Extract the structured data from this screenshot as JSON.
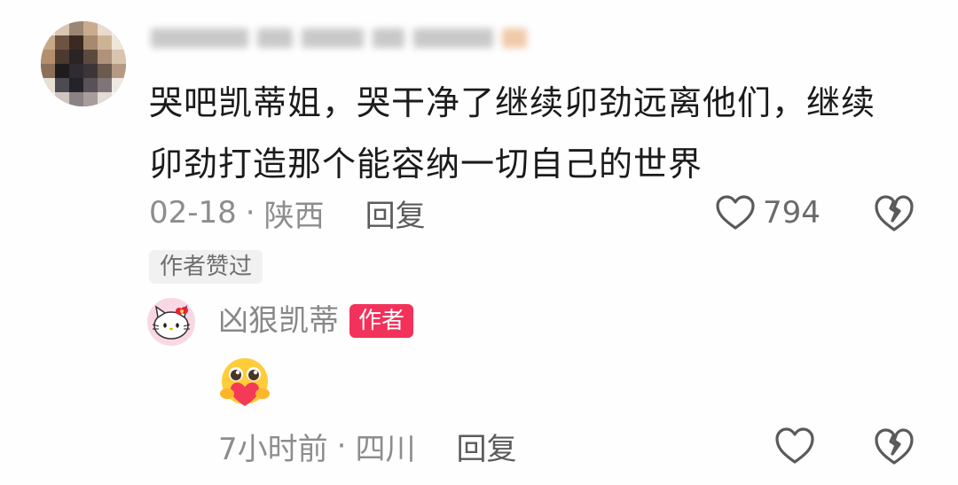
{
  "main_comment": {
    "text_line1": "哭吧凯蒂姐，哭干净了继续卯劲远离他们，继续",
    "text_line2": "卯劲打造那个能容纳一切自己的世界",
    "date": "02-18",
    "separator": "·",
    "location": "陕西",
    "reply_label": "回复",
    "like_count": "794",
    "author_liked_label": "作者赞过",
    "icons": {
      "like": "heart-outline-icon",
      "dislike": "broken-heart-icon"
    }
  },
  "reply": {
    "username": "凶狠凯蒂",
    "author_badge": "作者",
    "content_emoji": "heart-hug-emoji",
    "time": "7小时前",
    "separator": "·",
    "location": "四川",
    "reply_label": "回复",
    "icons": {
      "like": "heart-outline-icon",
      "dislike": "broken-heart-icon"
    }
  },
  "colors": {
    "text_primary": "#1b1b1b",
    "text_secondary": "#8d8d8d",
    "author_badge_bg": "#f2325a"
  }
}
